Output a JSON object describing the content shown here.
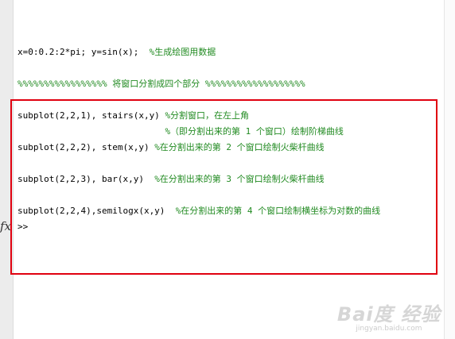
{
  "editor": {
    "lines": [
      {
        "code": "x=0:0.2:2*pi; y=sin(x);  ",
        "comment": "%生成绘图用数据"
      },
      {
        "code": "",
        "comment": "%%%%%%%%%%%%%%%%% 将窗口分割成四个部分 %%%%%%%%%%%%%%%%%%%"
      },
      {
        "code": "subplot(2,2,1), stairs(x,y) ",
        "comment": "%分割窗口，在左上角"
      },
      {
        "code": "                            ",
        "comment": "%（即分割出来的第 1 个窗口）绘制阶梯曲线"
      },
      {
        "code": "subplot(2,2,2), stem(x,y) ",
        "comment": "%在分割出来的第 2 个窗口绘制火柴杆曲线"
      },
      {
        "code": "subplot(2,2,3), bar(x,y)  ",
        "comment": "%在分割出来的第 3 个窗口绘制火柴杆曲线"
      },
      {
        "code": "subplot(2,2,4),semilogx(x,y)  ",
        "comment": "%在分割出来的第 4 个窗口绘制横坐标为对数的曲线"
      },
      {
        "code": ">>",
        "comment": ""
      }
    ]
  },
  "gutter": {
    "fx_label": "fx"
  },
  "watermark": {
    "logo": "Bai度 经验",
    "url": "jingyan.baidu.com"
  },
  "colors": {
    "highlight_border": "#e0000f",
    "comment": "#228b22"
  }
}
